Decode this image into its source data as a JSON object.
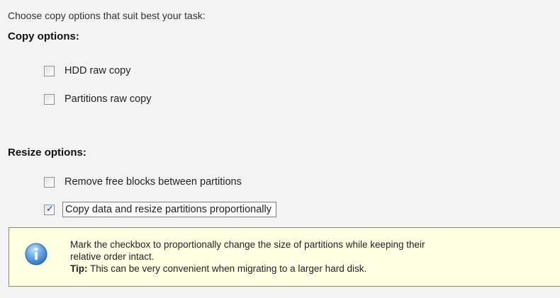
{
  "intro_text": "Choose copy options that suit best your task:",
  "copy_options": {
    "title": "Copy options:",
    "items": [
      {
        "label": "HDD raw copy",
        "checked": false
      },
      {
        "label": "Partitions raw copy",
        "checked": false
      }
    ]
  },
  "resize_options": {
    "title": "Resize options:",
    "items": [
      {
        "label": "Remove free blocks between partitions",
        "checked": false
      },
      {
        "label": "Copy data and resize partitions proportionally",
        "checked": true,
        "focused": true
      }
    ]
  },
  "tip": {
    "icon": "info-icon",
    "line1": "Mark the checkbox to proportionally change the size of partitions while keeping their",
    "line2": "relative order intact.",
    "tip_label": "Tip:",
    "tip_text": " This can be very convenient when migrating to a larger hard disk."
  },
  "colors": {
    "panel_background": "#f3f3f3",
    "tip_background": "#ffffe4",
    "info_icon_fill": "#3d8bd8"
  }
}
